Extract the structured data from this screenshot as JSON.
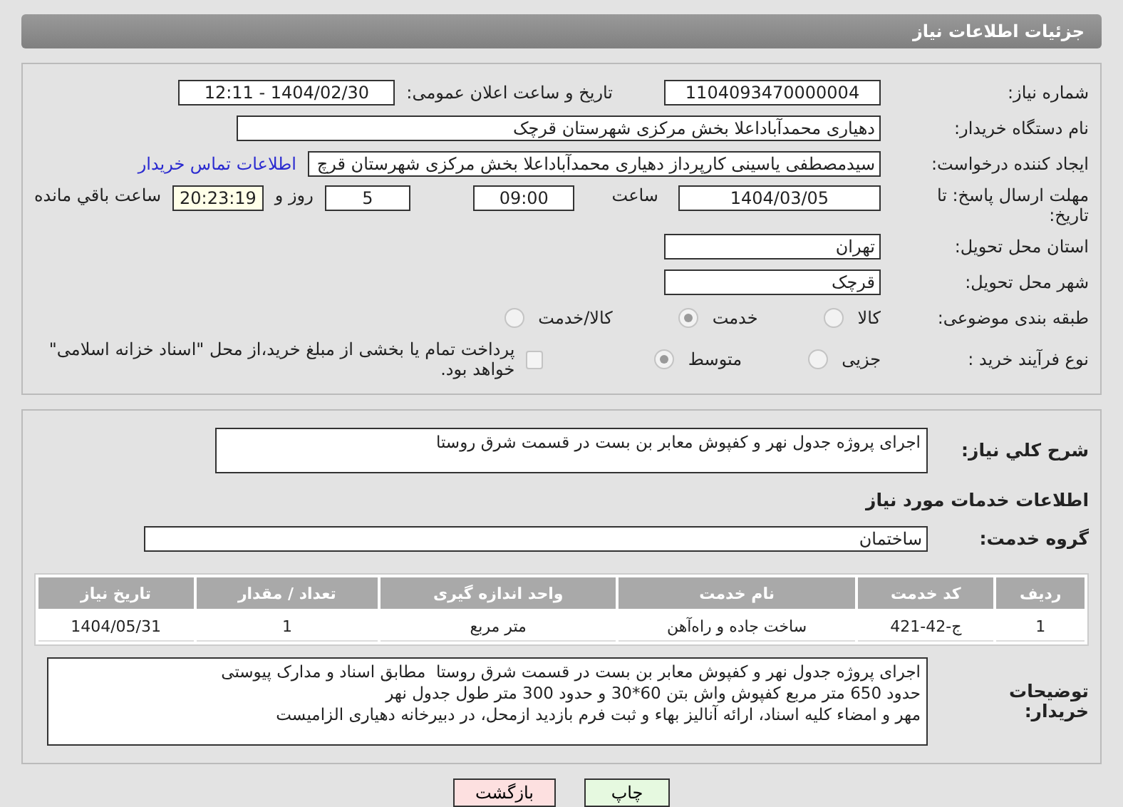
{
  "header": {
    "title": "جزئیات اطلاعات نیاز"
  },
  "need_number": {
    "label": "شماره نیاز:",
    "value": "1104093470000004"
  },
  "announce": {
    "label": "تاریخ و ساعت اعلان عمومی:",
    "value": "1404/02/30 - 12:11"
  },
  "buyer": {
    "label": "نام دستگاه خریدار:",
    "value": "دهیاری محمدآباداعلا بخش مرکزی شهرستان قرچک"
  },
  "creator": {
    "label": "ایجاد کننده درخواست:",
    "value": "سیدمصطفی یاسینی کارپرداز دهیاری محمدآباداعلا بخش مرکزی شهرستان قرچ",
    "link": "اطلاعات تماس خریدار"
  },
  "deadline": {
    "label": "مهلت ارسال پاسخ: تا تاریخ:",
    "date": "1404/03/05",
    "time_label": "ساعت",
    "time": "09:00",
    "days": "5",
    "days_label": "روز و",
    "remaining": "20:23:19",
    "remaining_label": "ساعت باقي مانده"
  },
  "province": {
    "label": "استان محل تحویل:",
    "value": "تهران"
  },
  "city": {
    "label": "شهر محل تحویل:",
    "value": "قرچک"
  },
  "category": {
    "label": "طبقه بندی موضوعی:",
    "options": [
      {
        "label": "کالا",
        "selected": false
      },
      {
        "label": "خدمت",
        "selected": true
      },
      {
        "label": "کالا/خدمت",
        "selected": false
      }
    ]
  },
  "purchase_type": {
    "label": "نوع فرآیند خرید :",
    "options": [
      {
        "label": "جزیی",
        "selected": false
      },
      {
        "label": "متوسط",
        "selected": true
      }
    ],
    "payment": {
      "checked": false,
      "text": "پرداخت تمام یا بخشی از مبلغ خرید،از محل \"اسناد خزانه اسلامی\" خواهد بود."
    }
  },
  "summary": {
    "label": "شرح کلي نیاز:",
    "value": "اجرای پروژه جدول نهر و کفپوش معابر بن بست در قسمت شرق روستا"
  },
  "services_title": "اطلاعات خدمات مورد نیاز",
  "service_group": {
    "label": "گروه خدمت:",
    "value": "ساختمان"
  },
  "table": {
    "columns": [
      "ردیف",
      "کد خدمت",
      "نام خدمت",
      "واحد اندازه گیری",
      "تعداد / مقدار",
      "تاریخ نیاز"
    ],
    "rows": [
      [
        "1",
        "ج-42-421",
        "ساخت جاده و راه‌آهن",
        "متر مربع",
        "1",
        "1404/05/31"
      ]
    ]
  },
  "buyer_notes": {
    "label": "توضیحات خریدار:",
    "value": "اجرای پروژه جدول نهر و کفپوش معابر بن بست در قسمت شرق روستا  مطابق اسناد و مدارک پیوستی\nحدود 650 متر مربع کفپوش واش بتن 60*30 و حدود 300 متر طول جدول نهر\nمهر و امضاء کلیه اسناد، ارائه آنالیز بهاء و ثبت فرم بازدید ازمحل، در دبیرخانه دهیاری الزامیست"
  },
  "buttons": [
    {
      "kind": "print",
      "label": "چاپ"
    },
    {
      "kind": "back",
      "label": "بازگشت"
    }
  ]
}
